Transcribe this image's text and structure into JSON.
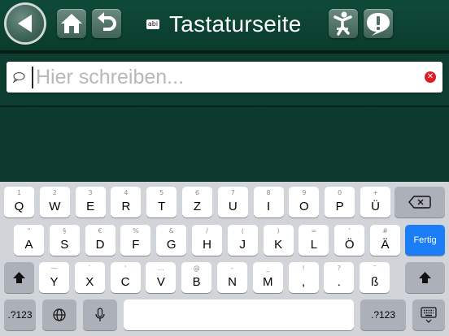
{
  "header": {
    "title": "Tastaturseite",
    "badge": "abi",
    "buttons": [
      "back-arrow-icon",
      "home-icon",
      "undo-icon",
      "person-icon",
      "alert-icon"
    ]
  },
  "input": {
    "placeholder": "Hier schreiben...",
    "value": ""
  },
  "keyboard": {
    "row1": [
      {
        "hint": "1",
        "key": "Q"
      },
      {
        "hint": "2",
        "key": "W"
      },
      {
        "hint": "3",
        "key": "E"
      },
      {
        "hint": "4",
        "key": "R"
      },
      {
        "hint": "5",
        "key": "T"
      },
      {
        "hint": "6",
        "key": "Z"
      },
      {
        "hint": "7",
        "key": "U"
      },
      {
        "hint": "8",
        "key": "I"
      },
      {
        "hint": "9",
        "key": "O"
      },
      {
        "hint": "0",
        "key": "P"
      },
      {
        "hint": "+",
        "key": "Ü"
      }
    ],
    "row2": [
      {
        "hint": "\"",
        "key": "A"
      },
      {
        "hint": "§",
        "key": "S"
      },
      {
        "hint": "€",
        "key": "D"
      },
      {
        "hint": "%",
        "key": "F"
      },
      {
        "hint": "&",
        "key": "G"
      },
      {
        "hint": "/",
        "key": "H"
      },
      {
        "hint": "(",
        "key": "J"
      },
      {
        "hint": ")",
        "key": "K"
      },
      {
        "hint": "=",
        "key": "L"
      },
      {
        "hint": "'",
        "key": "Ö"
      },
      {
        "hint": "#",
        "key": "Ä"
      }
    ],
    "row3": [
      {
        "hint": "—",
        "key": "Y"
      },
      {
        "hint": "`",
        "key": "X"
      },
      {
        "hint": "'",
        "key": "C"
      },
      {
        "hint": "…",
        "key": "V"
      },
      {
        "hint": "@",
        "key": "B"
      },
      {
        "hint": "-",
        "key": "N"
      },
      {
        "hint": "_",
        "key": "M"
      },
      {
        "hint": "!",
        "key": ","
      },
      {
        "hint": "?",
        "key": "."
      },
      {
        "hint": "˜",
        "key": "ß"
      }
    ],
    "done_label": "Fertig",
    "numbers_label": ".?123",
    "numbers_label_right": ".?123",
    "icons": [
      "backspace-icon",
      "shift-icon",
      "globe-icon",
      "microphone-icon",
      "keyboard-dismiss-icon"
    ]
  }
}
